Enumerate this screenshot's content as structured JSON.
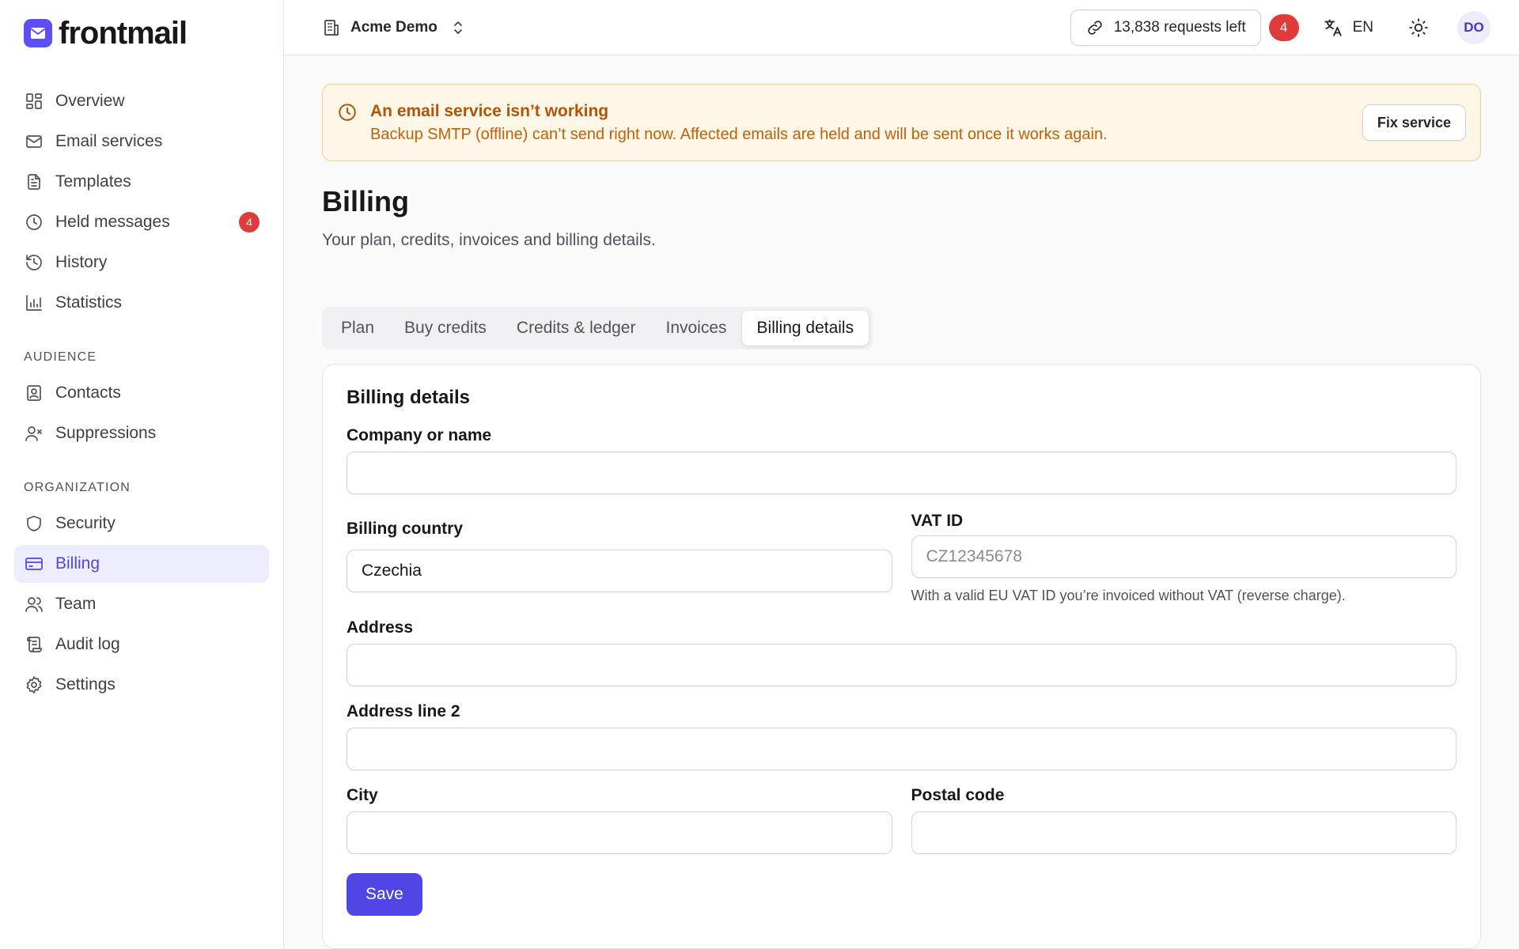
{
  "brand": {
    "name": "frontmail"
  },
  "sidebar": {
    "main_items": [
      {
        "label": "Overview",
        "icon": "grid-icon"
      },
      {
        "label": "Email services",
        "icon": "mail-icon"
      },
      {
        "label": "Templates",
        "icon": "document-icon"
      },
      {
        "label": "Held messages",
        "icon": "clock-icon",
        "badge": "4"
      },
      {
        "label": "History",
        "icon": "history-icon"
      },
      {
        "label": "Statistics",
        "icon": "bar-chart-icon"
      }
    ],
    "audience_section": "AUDIENCE",
    "audience_items": [
      {
        "label": "Contacts",
        "icon": "contact-card-icon"
      },
      {
        "label": "Suppressions",
        "icon": "user-x-icon"
      }
    ],
    "organization_section": "ORGANIZATION",
    "organization_items": [
      {
        "label": "Security",
        "icon": "shield-icon"
      },
      {
        "label": "Billing",
        "icon": "credit-card-icon",
        "active": true
      },
      {
        "label": "Team",
        "icon": "users-icon"
      },
      {
        "label": "Audit log",
        "icon": "scroll-icon"
      },
      {
        "label": "Settings",
        "icon": "gear-icon"
      }
    ]
  },
  "topbar": {
    "org_name": "Acme Demo",
    "requests_left": "13,838 requests left",
    "notification_count": "4",
    "language": "EN",
    "avatar_initials": "DO"
  },
  "alert": {
    "title": "An email service isn’t working",
    "body": "Backup SMTP (offline) can’t send right now. Affected emails are held and will be sent once it works again.",
    "action_label": "Fix service",
    "color": "#b45309"
  },
  "page": {
    "title": "Billing",
    "subtitle": "Your plan, credits, invoices and billing details."
  },
  "tabs": [
    {
      "label": "Plan"
    },
    {
      "label": "Buy credits"
    },
    {
      "label": "Credits & ledger"
    },
    {
      "label": "Invoices"
    },
    {
      "label": "Billing details",
      "active": true
    }
  ],
  "form": {
    "title": "Billing details",
    "company_label": "Company or name",
    "company_value": "",
    "country_label": "Billing country",
    "country_value": "Czechia",
    "vat_label": "VAT ID",
    "vat_value": "",
    "vat_placeholder": "CZ12345678",
    "vat_help": "With a valid EU VAT ID you’re invoiced without VAT (reverse charge).",
    "address_label": "Address",
    "address_value": "",
    "address2_label": "Address line 2",
    "address2_value": "",
    "city_label": "City",
    "city_value": "",
    "postal_label": "Postal code",
    "postal_value": "",
    "save_label": "Save"
  },
  "colors": {
    "accent": "#5046e5",
    "badge": "#e03b3b",
    "warning_bg": "#fef6e7"
  }
}
